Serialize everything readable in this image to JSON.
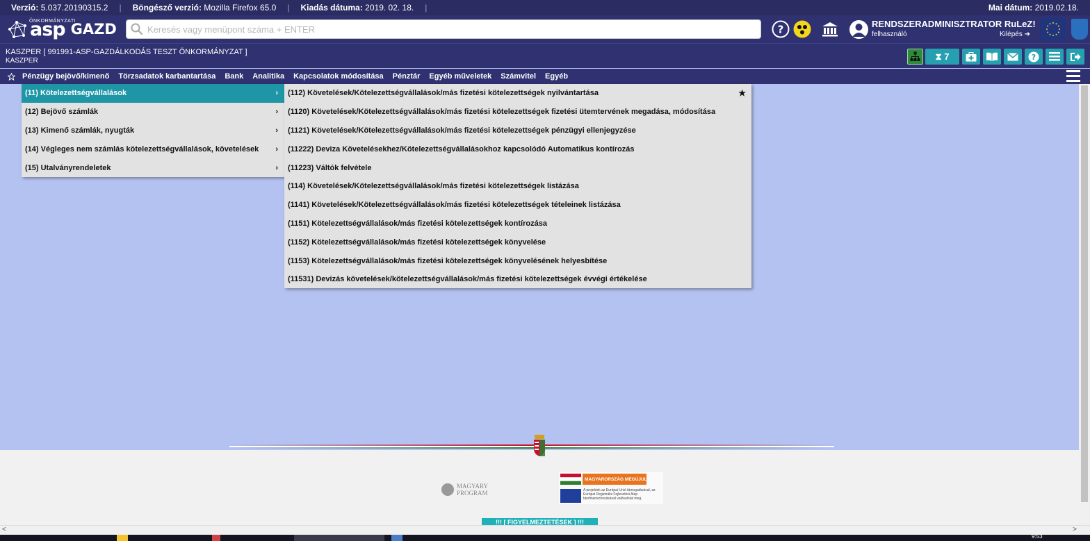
{
  "infobar": {
    "version_label": "Verzió:",
    "version_value": "5.037.20190315.2",
    "browser_label": "Böngésző verzió:",
    "browser_value": "Mozilla Firefox 65.0",
    "release_label": "Kiadás dátuma:",
    "release_value": "2019. 02. 18.",
    "today_label": "Mai dátum:",
    "today_value": "2019.02.18."
  },
  "header": {
    "logo_small": "ÖNKORMÁNYZATI",
    "logo_asp": "asp",
    "logo_gazd": "GAZD",
    "search_placeholder": "Keresés vagy menüpont száma + ENTER",
    "user_name": "RENDSZERADMINISZTRATOR RuLeZ!",
    "user_role": "felhasználó",
    "logout_label": "Kilépés"
  },
  "context": {
    "line1": "KASZPER [ 991991-ASP-GAZDÁLKODÁS TESZT ÖNKORMÁNYZAT ]",
    "line2": "KASZPER",
    "task_count": "7"
  },
  "menu": {
    "items": [
      "Pénzügy bejövő/kimenő",
      "Törzsadatok karbantartása",
      "Bank",
      "Analitika",
      "Kapcsolatok módosítása",
      "Pénztár",
      "Egyéb műveletek",
      "Számvitel",
      "Egyéb"
    ]
  },
  "submenu": {
    "items": [
      "(11) Kötelezettségvállalások",
      "(12) Bejövő számlák",
      "(13) Kimenő számlák, nyugták",
      "(14) Végleges nem számlás kötelezettségvállalások, követelések",
      "(15) Utalványrendeletek"
    ],
    "active_index": 0,
    "arrow": "›"
  },
  "subsubmenu": {
    "items": [
      "(112) Követelések/Kötelezettségvállalások/más fizetési kötelezettségek nyilvántartása",
      "(1120) Követelések/Kötelezettségvállalások/más fizetési kötelezettségek fizetési ütemtervének megadása, módosítása",
      "(1121) Követelések/Kötelezettségvállalások/más fizetési kötelezettségek pénzügyi ellenjegyzése",
      "(11222) Deviza Követelésekhez/Kötelezettségvállalásokhoz kapcsolódó Automatikus kontírozás",
      "(11223) Váltók felvétele",
      "(114) Követelések/Kötelezettségvállalások/más fizetési kötelezettségek listázása",
      "(1141) Követelések/Kötelezettségvállalások/más fizetési kötelezettségek tételeinek listázása",
      "(1151) Kötelezettségvállalások/más fizetési kötelezettségek kontírozása",
      "(1152) Kötelezettségvállalások/más fizetési kötelezettségek könyvelése",
      "(1153) Kötelezettségvállalások/más fizetési kötelezettségek könyvelésének helyesbítése",
      "(11531) Devizás követelések/kötelezettségvállalások/más fizetési kötelezettségek évvégi értékelése"
    ],
    "favorite_icon": "★"
  },
  "footer": {
    "magyary_line1": "MAGYARY",
    "magyary_line2": "PROGRAM",
    "mm_title": "MAGYARORSZÁG MEGÚJUL",
    "mm_text": "A projektek az Európai Unió támogatásával, az Európai Regionális Fejlesztési Alap társfinanszírozásával valósulnak meg.",
    "warning": "!!! [ FIGYELMEZTETÉSEK ] !!!"
  },
  "taskbar": {
    "clock": "9:53"
  },
  "colors": {
    "bar": "#2f3170",
    "accent": "#1e96a6",
    "background": "#b3c2f0"
  },
  "icons": [
    "search-icon",
    "help-icon",
    "accessibility-icon",
    "institution-icon",
    "user-icon",
    "logout-icon",
    "eu-flag-icon",
    "org-chart-icon",
    "hourglass-icon",
    "medkit-icon",
    "book-icon",
    "mail-icon",
    "question-icon",
    "list-icon",
    "exit-icon",
    "star-icon",
    "hamburger-icon"
  ]
}
